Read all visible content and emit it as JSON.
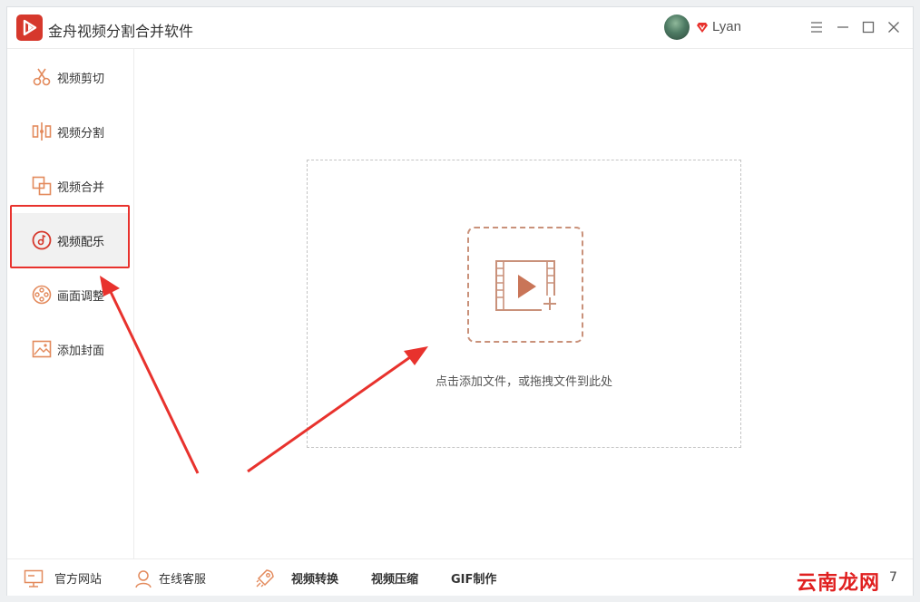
{
  "app": {
    "title": "金舟视频分割合并软件"
  },
  "user": {
    "name": "Lyan"
  },
  "sidebar": {
    "items": [
      {
        "label": "视频剪切",
        "icon": "scissors-icon"
      },
      {
        "label": "视频分割",
        "icon": "split-icon"
      },
      {
        "label": "视频合并",
        "icon": "merge-icon"
      },
      {
        "label": "视频配乐",
        "icon": "music-icon",
        "active": true
      },
      {
        "label": "画面调整",
        "icon": "film-reel-icon"
      },
      {
        "label": "添加封面",
        "icon": "image-icon"
      }
    ]
  },
  "main": {
    "drop_hint": "点击添加文件，或拖拽文件到此处"
  },
  "bottom": {
    "website": "官方网站",
    "support": "在线客服",
    "convert": "视频转换",
    "compress": "视频压缩",
    "gif": "GIF制作",
    "watermark": "云南龙网",
    "version": "7"
  },
  "colors": {
    "accent": "#d6382c",
    "icon": "#e38a5c",
    "annotation": "#e8322d",
    "drop_border": "#c9917a"
  }
}
